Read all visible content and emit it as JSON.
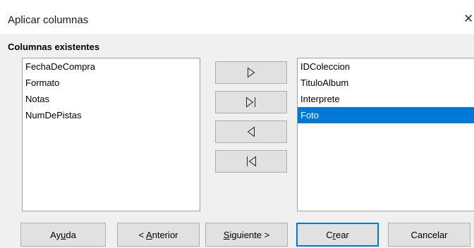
{
  "window": {
    "title": "Aplicar columnas",
    "close_glyph": "✕"
  },
  "section_label": "Columnas existentes",
  "existing_columns": [
    "FechaDeCompra",
    "Formato",
    "Notas",
    "NumDePistas"
  ],
  "applied_columns": [
    "IDColeccion",
    "TituloAlbum",
    "Interprete",
    "Foto"
  ],
  "selected_applied_column": "Foto",
  "mover_buttons": [
    {
      "name": "move-right-button",
      "icon": "triangle-right-icon"
    },
    {
      "name": "move-all-right-button",
      "icon": "triangle-right-bar-icon"
    },
    {
      "name": "move-left-button",
      "icon": "triangle-left-icon"
    },
    {
      "name": "move-all-left-button",
      "icon": "bar-triangle-left-icon"
    }
  ],
  "buttons": {
    "help": {
      "pre": "Ay",
      "mnemonic": "u",
      "post": "da"
    },
    "back": {
      "pre": "< ",
      "mnemonic": "A",
      "post": "nterior"
    },
    "next": {
      "pre": "",
      "mnemonic": "S",
      "post": "iguiente >"
    },
    "create": {
      "pre": "C",
      "mnemonic": "r",
      "post": "ear"
    },
    "cancel": {
      "pre": "Cancelar",
      "mnemonic": "",
      "post": ""
    }
  },
  "colors": {
    "selection": "#0078d7",
    "button_face": "#e1e1e1",
    "dialog_bg": "#f0f0f0"
  }
}
